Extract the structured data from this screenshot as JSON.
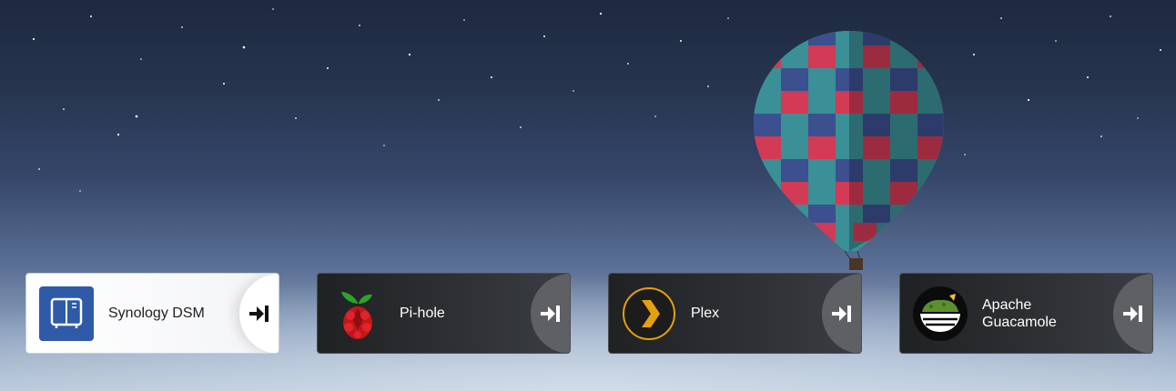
{
  "services": [
    {
      "name": "Synology DSM",
      "theme": "light",
      "icon": "synology-nas-icon",
      "launch_icon": "launch-arrow-icon"
    },
    {
      "name": "Pi-hole",
      "theme": "dark",
      "icon": "pihole-raspberry-icon",
      "launch_icon": "launch-arrow-icon"
    },
    {
      "name": "Plex",
      "theme": "dark",
      "icon": "plex-chevron-icon",
      "launch_icon": "launch-arrow-icon"
    },
    {
      "name_lines": [
        "Apache",
        "Guacamole"
      ],
      "theme": "dark",
      "icon": "guacamole-bowl-icon",
      "launch_icon": "launch-arrow-icon"
    }
  ],
  "colors": {
    "synology_blue": "#2f5aa8",
    "plex_orange": "#e5a00d",
    "pihole_red": "#c0171a",
    "pihole_green": "#2aa32a",
    "guacamole_green": "#5c8f2f"
  }
}
